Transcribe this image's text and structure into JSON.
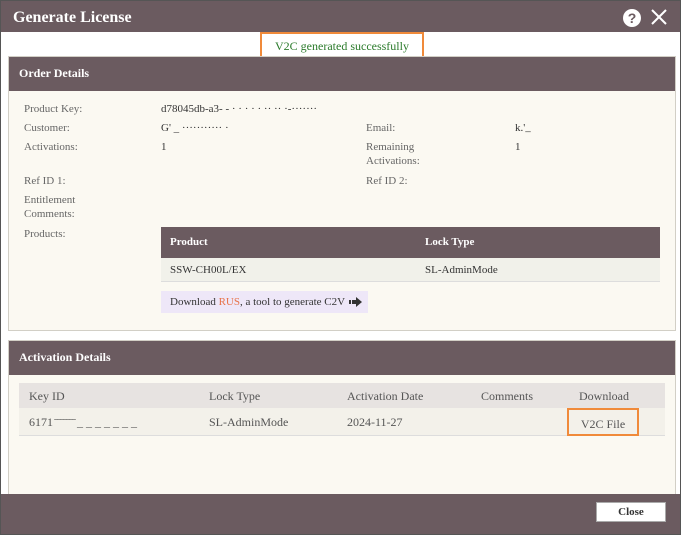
{
  "window": {
    "title": "Generate License"
  },
  "success_message": "V2C generated successfully",
  "order": {
    "section_title": "Order Details",
    "fields": {
      "product_key_label": "Product Key:",
      "product_key_value": "d78045db-a3-  - · · · · ·  ·· ·· ·-·······",
      "customer_label": "Customer:",
      "customer_value": "G'   _     ··········· ·",
      "email_label": "Email:",
      "email_value": "k.'          ̲",
      "activations_label": "Activations:",
      "activations_value": "1",
      "remaining_label": "Remaining Activations:",
      "remaining_value": "1",
      "ref1_label": "Ref ID 1:",
      "ref2_label": "Ref ID 2:",
      "entitlement_label": "Entitlement Comments:",
      "products_label": "Products:"
    },
    "products_table": {
      "headers": [
        "Product",
        "Lock Type"
      ],
      "rows": [
        [
          "SSW-CH00L/EX",
          "SL-AdminMode"
        ]
      ]
    },
    "rus": {
      "prefix": "Download ",
      "link": "RUS",
      "suffix": ", a tool to generate C2V"
    }
  },
  "activation": {
    "section_title": "Activation Details",
    "headers": [
      "Key ID",
      "Lock Type",
      "Activation Date",
      "Comments",
      "Download"
    ],
    "rows": [
      {
        "key_id": "6171 ̄ ̄ ̄ ̄ ̄ ̄ ̄ _ _ _ _ _ _ _",
        "lock_type": "SL-AdminMode",
        "date": "2024-11-27",
        "comments": "",
        "download": "V2C File"
      }
    ]
  },
  "buttons": {
    "close": "Close"
  },
  "colors": {
    "header": "#6b5b60",
    "accent": "#f08a3a",
    "link": "#e8734a",
    "success": "#2a7a2a"
  }
}
